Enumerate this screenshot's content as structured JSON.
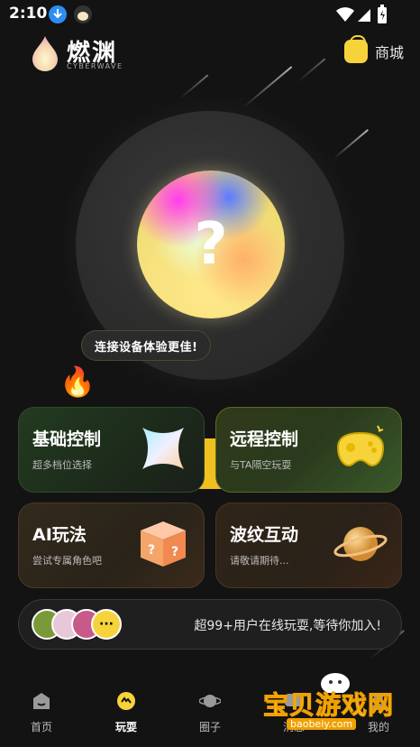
{
  "status_bar": {
    "time": "2:10"
  },
  "header": {
    "logo_text": "燃渊",
    "logo_sub": "CYBERWAVE",
    "shop_label": "商城"
  },
  "center": {
    "orb_symbol": "?",
    "tooltip": "连接设备体验更佳!"
  },
  "cards": [
    {
      "title": "基础控制",
      "subtitle": "超多档位选择",
      "art_icon": "star-shape-icon"
    },
    {
      "title": "远程控制",
      "subtitle": "与TA隔空玩耍",
      "art_icon": "gamepad-icon"
    },
    {
      "title": "AI玩法",
      "subtitle": "尝试专属角色吧",
      "art_icon": "mystery-box-icon"
    },
    {
      "title": "波纹互动",
      "subtitle": "请敬请期待...",
      "art_icon": "planet-icon"
    }
  ],
  "online": {
    "text": "超99+用户在线玩耍,等待你加入!",
    "more": "···"
  },
  "nav": [
    {
      "label": "首页",
      "icon": "home-icon"
    },
    {
      "label": "玩耍",
      "icon": "play-icon"
    },
    {
      "label": "圈子",
      "icon": "planet-icon"
    },
    {
      "label": "消息",
      "icon": "message-icon"
    },
    {
      "label": "我的",
      "icon": "profile-icon"
    }
  ],
  "watermark": {
    "text": "宝贝游戏网",
    "url": "baobeiy.com"
  },
  "colors": {
    "accent": "#f6d33a",
    "background": "#131313"
  }
}
